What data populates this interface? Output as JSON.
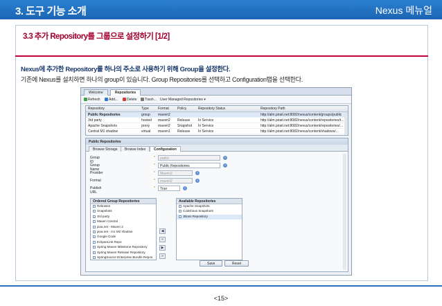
{
  "header": {
    "title": "3. 도구 기능 소개",
    "right_label": "Nexus 메뉴얼",
    "bg_color": "#1f6cbb"
  },
  "section": {
    "title": "3.3 추가 Repository를 그룹으로 설정하기 [1/2]",
    "accent_color": "#c0003a"
  },
  "body": {
    "line1": "Nexus에 추가한 Repository를 하나의 주소로 사용하기 위해 Group을 설정한다.",
    "line2": "기존에 Nexus를 설치하면 하나의 group이 있습니다. Group Repositories를 선택하고 Configuration탭을 선택한다."
  },
  "screenshot": {
    "tabs": [
      "Welcome",
      "Repositories"
    ],
    "toolbar": {
      "refresh": "Refresh",
      "add": "Add...",
      "delete": "Delete",
      "trash": "Trash...",
      "filter": "User Managed Repositories"
    },
    "grid": {
      "columns": [
        "Repository",
        "Type",
        "Format",
        "Policy",
        "Repository Status",
        "Repository Path"
      ],
      "rows": [
        [
          "Public Repositories",
          "group",
          "maven2",
          "",
          "",
          "http://alm.pirati.net:8082/nexus/content/groups/public"
        ],
        [
          "3rd party",
          "hosted",
          "maven2",
          "Release",
          "In Service",
          "http://alm.pirati.net:8082/nexus/content/repositories/t..."
        ],
        [
          "Apache Snapshots",
          "proxy",
          "maven2",
          "Snapshot",
          "In Service",
          "http://alm.pirati.net:8082/nexus/content/repositories/..."
        ],
        [
          "Central M1 shadow",
          "virtual",
          "maven1",
          "Release",
          "In Service",
          "http://alm.pirati.net:8082/nexus/content/shadows/..."
        ]
      ]
    },
    "panel": {
      "title": "Public Repositories",
      "tabs": [
        "Browse Storage",
        "Browse Index",
        "Configuration"
      ],
      "form": {
        "group_id_label": "Group ID",
        "group_id_value": "public",
        "group_name_label": "Group Name",
        "group_name_value": "Public Repositories",
        "provider_label": "Provider",
        "provider_value": "Maven2",
        "format_label": "Format",
        "format_value": "maven2",
        "publish_url_label": "Publish URL",
        "publish_url_value": "True"
      },
      "ordered_title": "Ordered Group Repositories",
      "ordered_items": [
        "Releases",
        "Snapshots",
        "3rd party",
        "Maven Central",
        "java.net - Maven 2",
        "java.net - m1 M2 shadow",
        "Google Code",
        "EclipseLink Repo",
        "Spring Maven Milestone Repository",
        "Spring Maven Release Repository",
        "SpringSource Enterprise Bundle Repos"
      ],
      "available_title": "Available Repositories",
      "available_items": [
        "Apache Snapshots",
        "Codehaus Snapshots",
        "JBoss Repository"
      ],
      "save_label": "Save",
      "reset_label": "Reset"
    }
  },
  "footer": {
    "page_number": "<15>"
  }
}
